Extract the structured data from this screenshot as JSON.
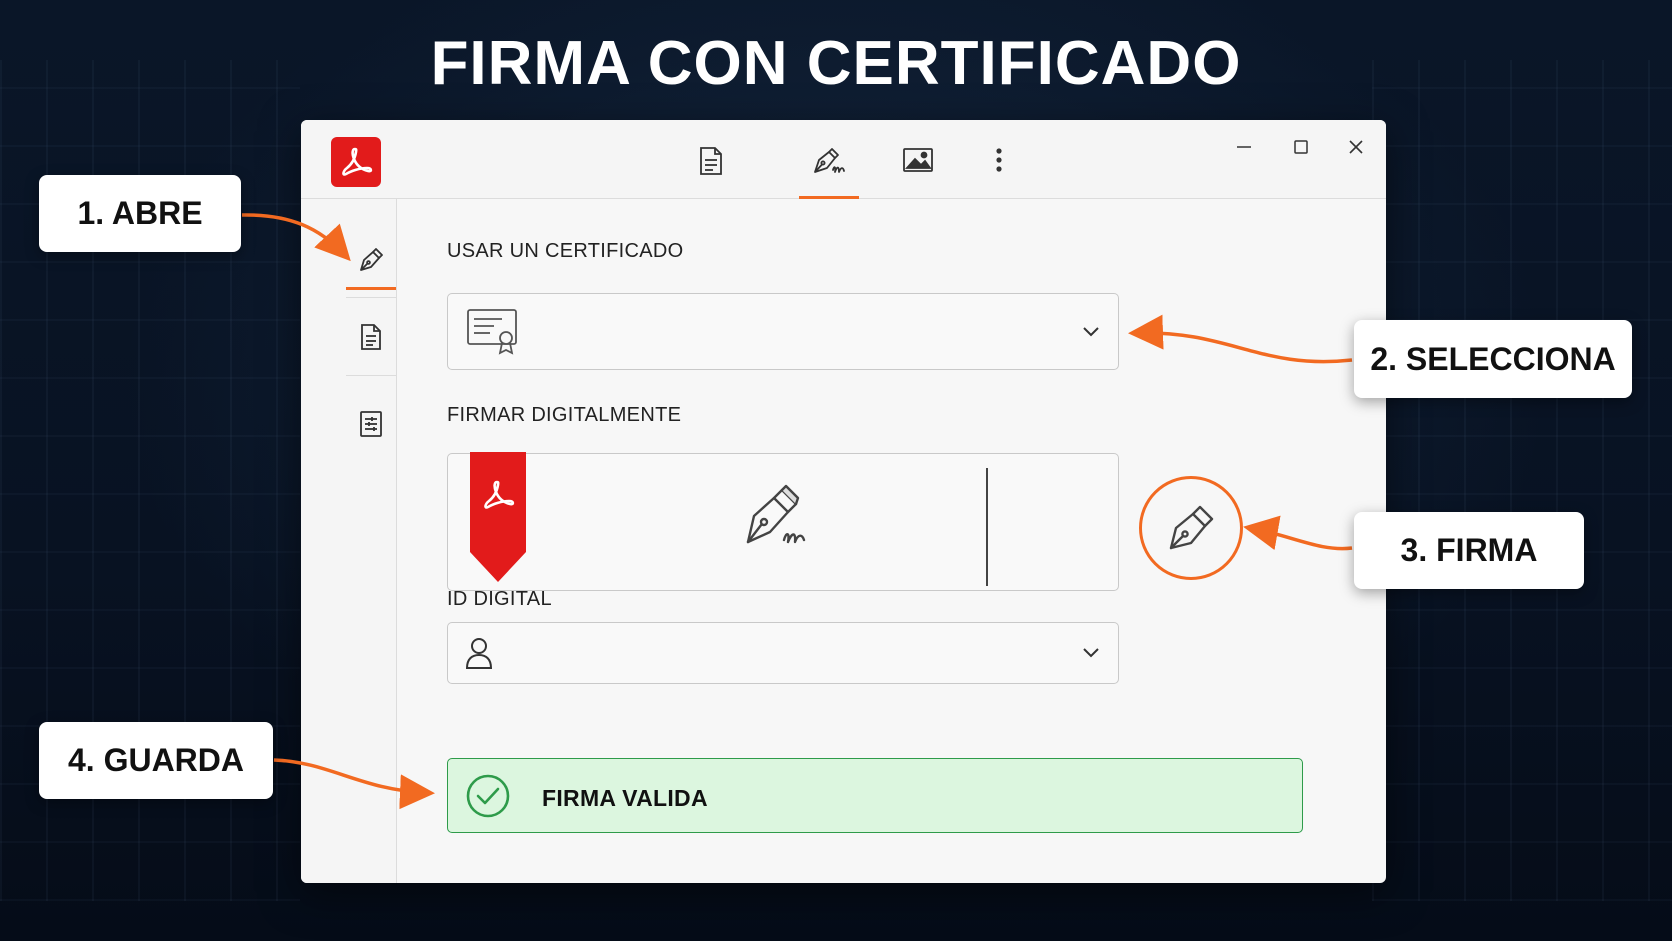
{
  "page": {
    "title": "FIRMA CON CERTIFICADO"
  },
  "colors": {
    "accent": "#f26a21",
    "adobe_red": "#e21b1b",
    "valid_green": "#2e9b4a",
    "valid_bg": "#dcf6df"
  },
  "window": {
    "app_icon": "acrobat-logo-icon",
    "toolbar_tabs": [
      {
        "icon": "document-icon",
        "active": false
      },
      {
        "icon": "signature-pen-icon",
        "active": true
      },
      {
        "icon": "image-icon",
        "active": false
      },
      {
        "icon": "more-vertical-icon",
        "active": false
      }
    ],
    "controls": [
      "minimize-icon",
      "maximize-icon",
      "close-icon"
    ],
    "sidebar": [
      {
        "icon": "pen-icon",
        "active": true
      },
      {
        "icon": "document-icon",
        "active": false
      },
      {
        "icon": "form-list-icon",
        "active": false
      }
    ]
  },
  "form": {
    "certificate": {
      "label": "USAR UN CERTIFICADO",
      "icon": "certificate-icon",
      "value": ""
    },
    "sign": {
      "label": "FIRMAR DIGITALMENTE",
      "icon": "signature-pen-icon"
    },
    "digital_id": {
      "label": "ID DIGITAL",
      "icon": "user-icon",
      "value": ""
    },
    "status": {
      "text": "FIRMA VALIDA",
      "icon": "check-circle-icon"
    }
  },
  "steps": [
    {
      "label": "1. ABRE"
    },
    {
      "label": "2. SELECCIONA"
    },
    {
      "label": "3. FIRMA"
    },
    {
      "label": "4. GUARDA"
    }
  ]
}
